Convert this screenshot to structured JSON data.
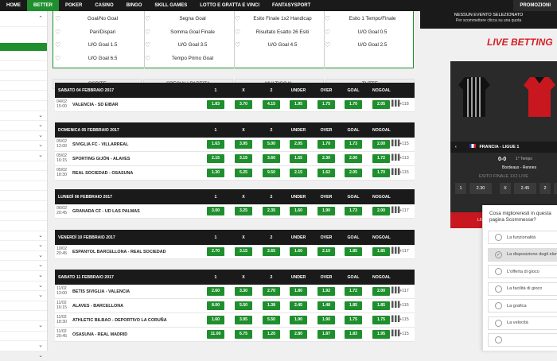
{
  "nav": {
    "tabs": [
      "HOME",
      "BETTER",
      "POKER",
      "CASINO",
      "BINGO",
      "SKILL GAMES",
      "LOTTO E GRATTA E VINCI",
      "FANTASYSPORT"
    ],
    "active": "BETTER",
    "promo_label": "PROMOZIONI"
  },
  "stats_cols": [
    [
      "Goal/No Goal",
      "Pari/Dispari",
      "U/O Goal 1.5",
      "U/O Goal 6.5"
    ],
    [
      "Segna Goal",
      "Somma Goal Finale",
      "U/O Goal 3.5",
      "Tempo Primo Goal"
    ],
    [
      "Esito Finale 1x2 Handicap",
      "Risultato Esatto 26 Esiti",
      "U/O Goal 4.5"
    ],
    [
      "Esito 1 Tempo/Finale",
      "U/O Goal 0.5",
      "U/O Goal 2.5"
    ]
  ],
  "filters": [
    "OSPITE",
    "SPECIALI PARTITA",
    "MULTIGOAL",
    "TUTTE"
  ],
  "headers": [
    "1",
    "X",
    "2",
    "UNDER",
    "OVER",
    "GOAL",
    "NOGOAL"
  ],
  "days": [
    {
      "label": "SABATO 04 FEBBRAIO 2017",
      "events": [
        {
          "d": "04/02",
          "t": "15:00",
          "name": "VALENCIA - SD EIBAR",
          "odds": [
            "1.83",
            "3.70",
            "4.15",
            "1.95",
            "1.75",
            "1.70",
            "2.05"
          ],
          "more": "+118"
        }
      ]
    },
    {
      "label": "DOMENICA 05 FEBBRAIO 2017",
      "events": [
        {
          "d": "05/02",
          "t": "12:00",
          "name": "SIVIGLIA FC - VILLARREAL",
          "odds": [
            "1.63",
            "3.95",
            "5.00",
            "2.05",
            "1.70",
            "1.73",
            "2.00"
          ],
          "more": "+115"
        },
        {
          "d": "05/02",
          "t": "16:15",
          "name": "SPORTING GIJÓN - ALAVES",
          "odds": [
            "2.15",
            "3.15",
            "3.60",
            "1.55",
            "2.30",
            "2.00",
            "1.72"
          ],
          "more": "+113"
        },
        {
          "d": "05/02",
          "t": "18:30",
          "name": "REAL SOCIEDAD - OSASUNA",
          "odds": [
            "1.30",
            "5.25",
            "9.50",
            "2.15",
            "1.62",
            "2.05",
            "1.70"
          ],
          "more": "+115"
        }
      ]
    },
    {
      "label": "LUNEDÌ 06 FEBBRAIO 2017",
      "events": [
        {
          "d": "06/02",
          "t": "20:45",
          "name": "GRANADA CF - UD LAS PALMAS",
          "odds": [
            "3.00",
            "3.25",
            "2.35",
            "1.60",
            "1.90",
            "1.73",
            "2.00"
          ],
          "more": "+117"
        }
      ]
    },
    {
      "label": "VENERDÌ 10 FEBBRAIO 2017",
      "events": [
        {
          "d": "10/02",
          "t": "20:45",
          "name": "ESPANYOL BARCELLONA - REAL SOCIEDAD",
          "odds": [
            "2.70",
            "3.15",
            "2.65",
            "1.60",
            "2.10",
            "1.85",
            "1.85"
          ],
          "more": "+117"
        }
      ]
    },
    {
      "label": "SABATO 11 FEBBRAIO 2017",
      "events": [
        {
          "d": "11/02",
          "t": "13:00",
          "name": "BETIS SIVIGLIA - VALENCIA",
          "odds": [
            "2.60",
            "3.30",
            "2.70",
            "1.80",
            "1.92",
            "1.72",
            "2.00"
          ],
          "more": "+117"
        },
        {
          "d": "11/02",
          "t": "16:15",
          "name": "ALAVES - BARCELLONA",
          "odds": [
            "8.00",
            "5.50",
            "1.38",
            "2.45",
            "1.48",
            "1.85",
            "1.85"
          ],
          "more": "+115"
        },
        {
          "d": "11/02",
          "t": "18:30",
          "name": "ATHLETIC BILBAO - DEPORTIVO LA CORUÑA",
          "odds": [
            "1.60",
            "3.95",
            "5.50",
            "1.90",
            "1.90",
            "1.75",
            "1.75"
          ],
          "more": "+115"
        },
        {
          "d": "11/02",
          "t": "20:45",
          "name": "OSASUNA - REAL MADRID",
          "odds": [
            "11.00",
            "6.75",
            "1.20",
            "2.80",
            "1.87",
            "1.83",
            "1.95"
          ],
          "more": "+115"
        }
      ]
    }
  ],
  "right": {
    "no_event": "NESSUN EVENTO SELEZIONATO",
    "no_event_sub": "Per scommettere clicca su una quota",
    "live_title": "LIVE BETTING",
    "league": "FRANCIA - LIGUE 1",
    "score": "0-0",
    "phase": "1° Tempo",
    "teams": "Bordeaux - Rennes",
    "market": "ESITO FINALE 1X2 LIVE",
    "odds": [
      [
        "1",
        "2.30"
      ],
      [
        "X",
        "2.45"
      ],
      [
        "2",
        ""
      ]
    ],
    "live_btn": "LIV"
  },
  "survey": {
    "question": "Cosa miglioreresti in questa pagina Scommesse?",
    "options": [
      "La funzionalità",
      "La disposizione degli elementi",
      "L'offerta di gioco",
      "La facilità di gioco",
      "La grafica",
      "La velocità",
      ""
    ],
    "selected": 1
  }
}
